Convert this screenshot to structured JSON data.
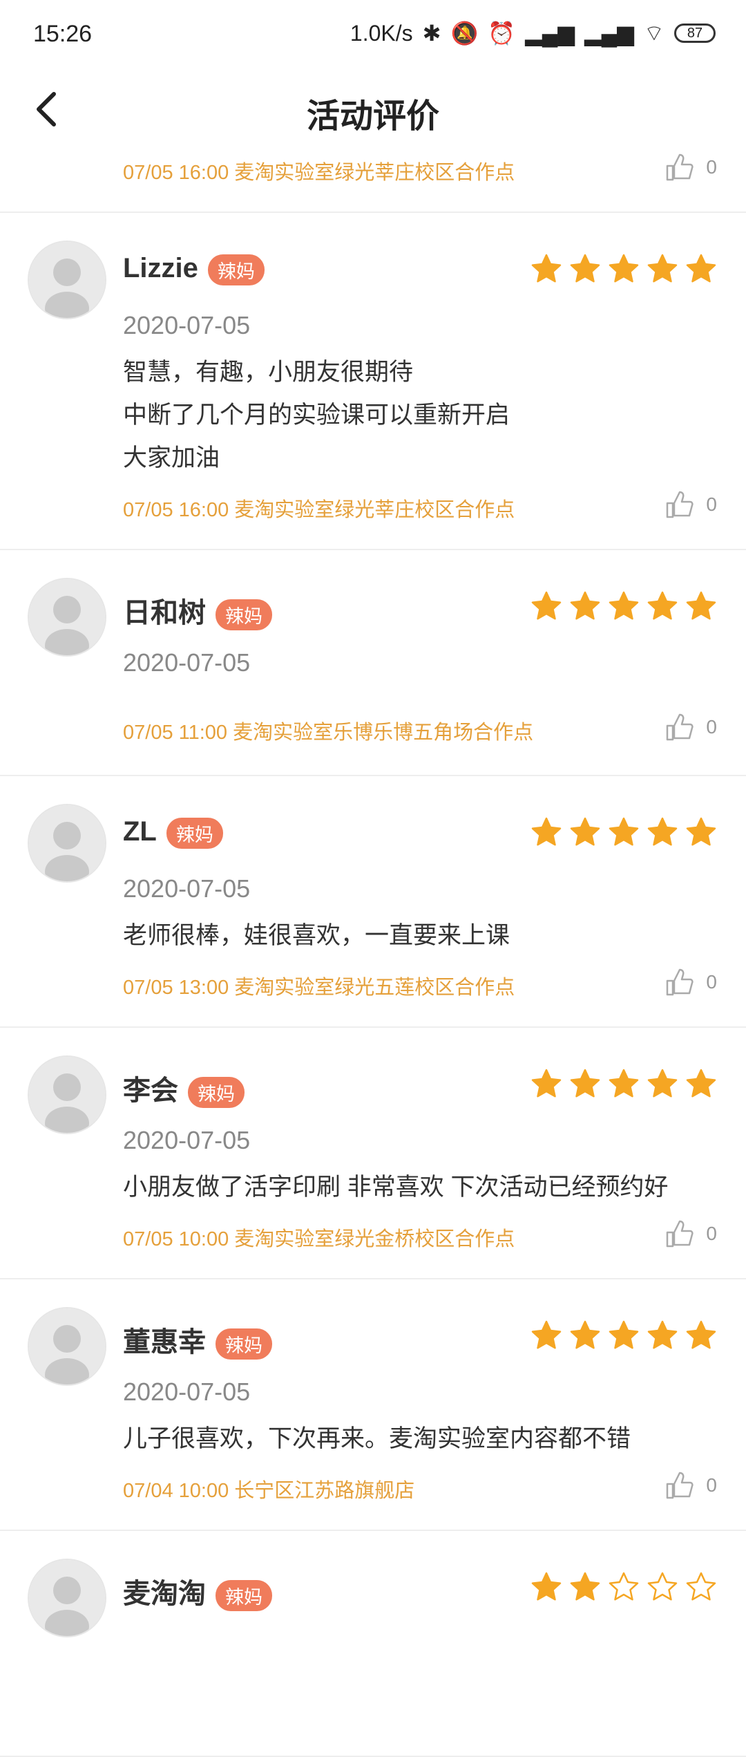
{
  "status_bar": {
    "time": "15:26",
    "net_speed": "1.0K/s",
    "battery": "87"
  },
  "header": {
    "title": "活动评价"
  },
  "colors": {
    "accent": "#e5a03b",
    "badge": "#f07c5b",
    "star": "#f5a623"
  },
  "first_meta": {
    "text": "07/05 16:00 麦淘实验室绿光莘庄校区合作点",
    "likes": "0"
  },
  "reviews": [
    {
      "name": "Lizzie",
      "badge": "辣妈",
      "rating": 5,
      "date": "2020-07-05",
      "lines": [
        "智慧，有趣，小朋友很期待",
        "中断了几个月的实验课可以重新开启",
        "大家加油"
      ],
      "meta": "07/05 16:00 麦淘实验室绿光莘庄校区合作点",
      "likes": "0"
    },
    {
      "name": "日和树",
      "badge": "辣妈",
      "rating": 5,
      "date": "2020-07-05",
      "lines": [],
      "meta": "07/05 11:00 麦淘实验室乐博乐博五角场合作点",
      "likes": "0"
    },
    {
      "name": "ZL",
      "badge": "辣妈",
      "rating": 5,
      "date": "2020-07-05",
      "lines": [
        "老师很棒，娃很喜欢，一直要来上课"
      ],
      "meta": "07/05 13:00 麦淘实验室绿光五莲校区合作点",
      "likes": "0"
    },
    {
      "name": "李会",
      "badge": "辣妈",
      "rating": 5,
      "date": "2020-07-05",
      "lines": [
        "小朋友做了活字印刷 非常喜欢 下次活动已经预约好"
      ],
      "meta": "07/05 10:00 麦淘实验室绿光金桥校区合作点",
      "likes": "0"
    },
    {
      "name": "董惠幸",
      "badge": "辣妈",
      "rating": 5,
      "date": "2020-07-05",
      "lines": [
        "儿子很喜欢，下次再来。麦淘实验室内容都不错"
      ],
      "meta": "07/04 10:00 长宁区江苏路旗舰店",
      "likes": "0"
    },
    {
      "name": "麦淘淘",
      "badge": "辣妈",
      "rating": 2,
      "date": "",
      "lines": [],
      "meta": "",
      "likes": ""
    }
  ]
}
